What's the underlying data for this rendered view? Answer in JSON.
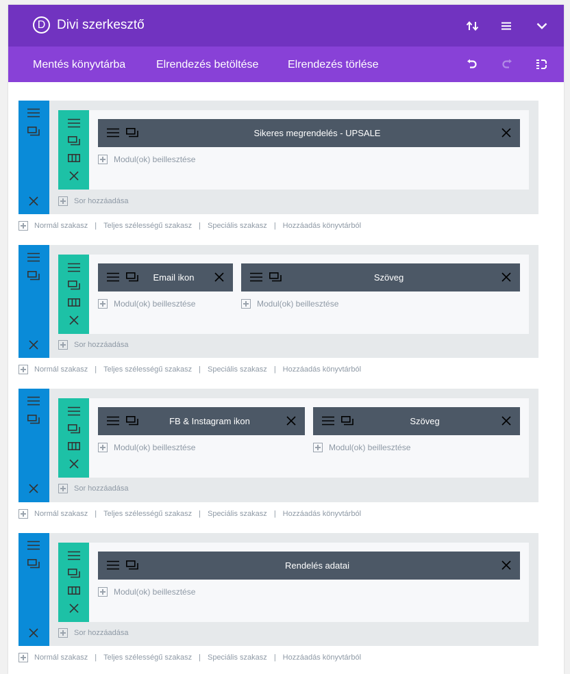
{
  "app": {
    "logo_letter": "D",
    "title": "Divi szerkesztő"
  },
  "header_icons": [
    "sort-arrows-icon",
    "hamburger-menu-icon",
    "chevron-down-icon"
  ],
  "menu": {
    "save_library": "Mentés könyvtárba",
    "load_layout": "Elrendezés betöltése",
    "clear_layout": "Elrendezés törlése"
  },
  "menu_icons": [
    "undo-icon",
    "redo-icon",
    "history-icon"
  ],
  "labels": {
    "add_module": "Modul(ok) beillesztése",
    "add_row": "Sor hozzáadása",
    "normal_section": "Normál szakasz",
    "fullwidth_section": "Teljes szélességű szakasz",
    "special_section": "Speciális szakasz",
    "add_from_library": "Hozzáadás könyvtárból",
    "separator": "|"
  },
  "sections": [
    {
      "modules": [
        {
          "title": "Sikeres megrendelés - UPSALE"
        }
      ]
    },
    {
      "modules": [
        {
          "title": "Email ikon"
        },
        {
          "title": "Szöveg"
        }
      ]
    },
    {
      "modules": [
        {
          "title": "FB & Instagram ikon"
        },
        {
          "title": "Szöveg"
        }
      ]
    },
    {
      "modules": [
        {
          "title": "Rendelés adatai"
        }
      ]
    }
  ],
  "colors": {
    "header_dark": "#7133c0",
    "header_light": "#8841d7",
    "section_handle": "#0a8bd8",
    "row_handle": "#1dc1a6",
    "module_bg": "#4c5866"
  }
}
